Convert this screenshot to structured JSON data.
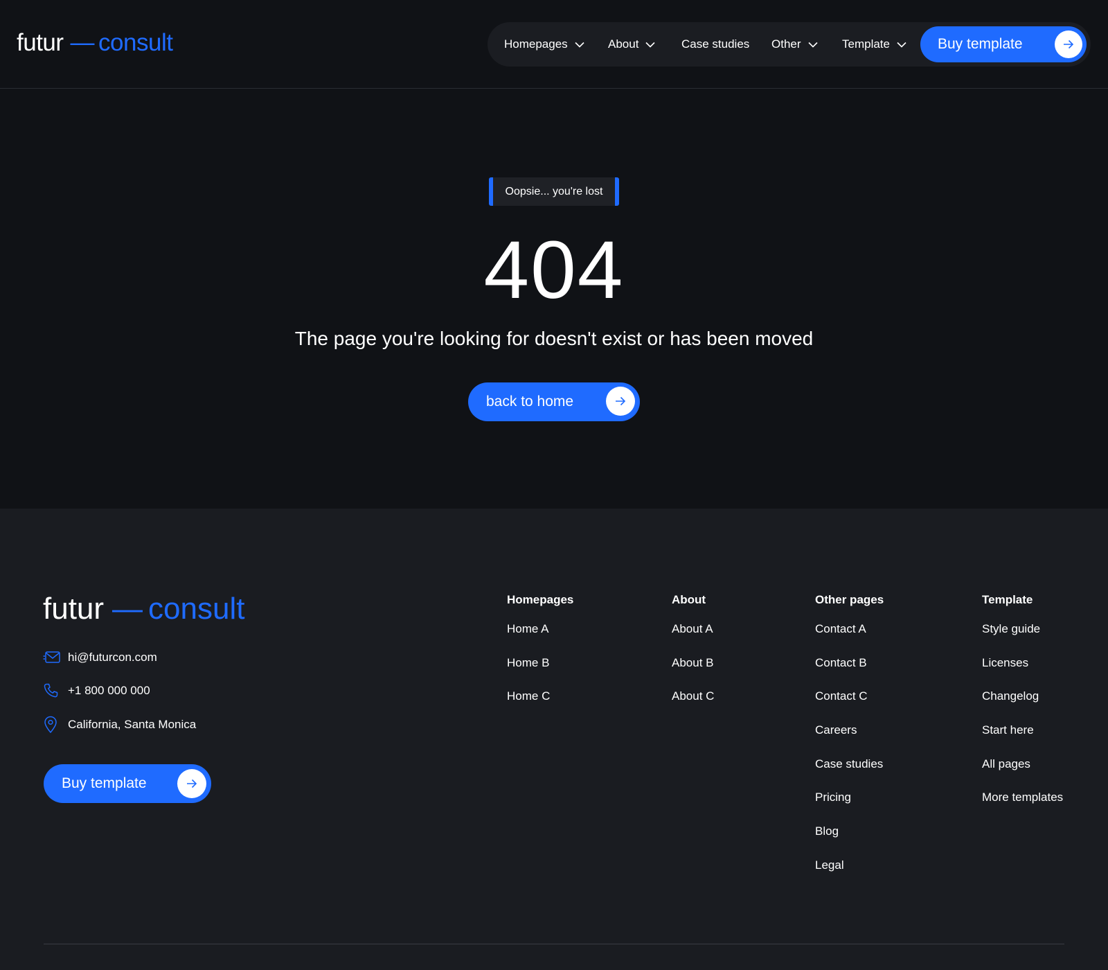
{
  "brand": {
    "word1": "futur",
    "dash": "—",
    "word2": "consult"
  },
  "colors": {
    "accent": "#1f6bff",
    "background": "#101216",
    "footer": "#1a1c21",
    "nav_pill": "#1b1d22"
  },
  "nav": {
    "items": [
      {
        "label": "Homepages",
        "dropdown": true
      },
      {
        "label": "About",
        "dropdown": true
      },
      {
        "label": "Case studies",
        "dropdown": false
      },
      {
        "label": "Other",
        "dropdown": true
      },
      {
        "label": "Template",
        "dropdown": true
      }
    ],
    "buy_label": "Buy template"
  },
  "hero": {
    "badge": "Oopsie... you're lost",
    "code": "404",
    "message": "The page you're looking for doesn't exist or has been moved",
    "button": "back to home"
  },
  "footer": {
    "contacts": {
      "email": "hi@futurcon.com",
      "phone": "+1 800 000 000",
      "address": "California, Santa Monica"
    },
    "buy_label": "Buy template",
    "columns": [
      {
        "title": "Homepages",
        "links": [
          "Home A",
          "Home B",
          "Home C"
        ]
      },
      {
        "title": "About",
        "links": [
          "About A",
          "About B",
          "About C"
        ]
      },
      {
        "title": "Other pages",
        "links": [
          "Contact A",
          "Contact B",
          "Contact C",
          "Careers",
          "Case studies",
          "Pricing",
          "Blog",
          "Legal"
        ]
      },
      {
        "title": "Template",
        "links": [
          "Style guide",
          "Licenses",
          "Changelog",
          "Start here",
          "All pages",
          "More templates"
        ]
      }
    ]
  }
}
